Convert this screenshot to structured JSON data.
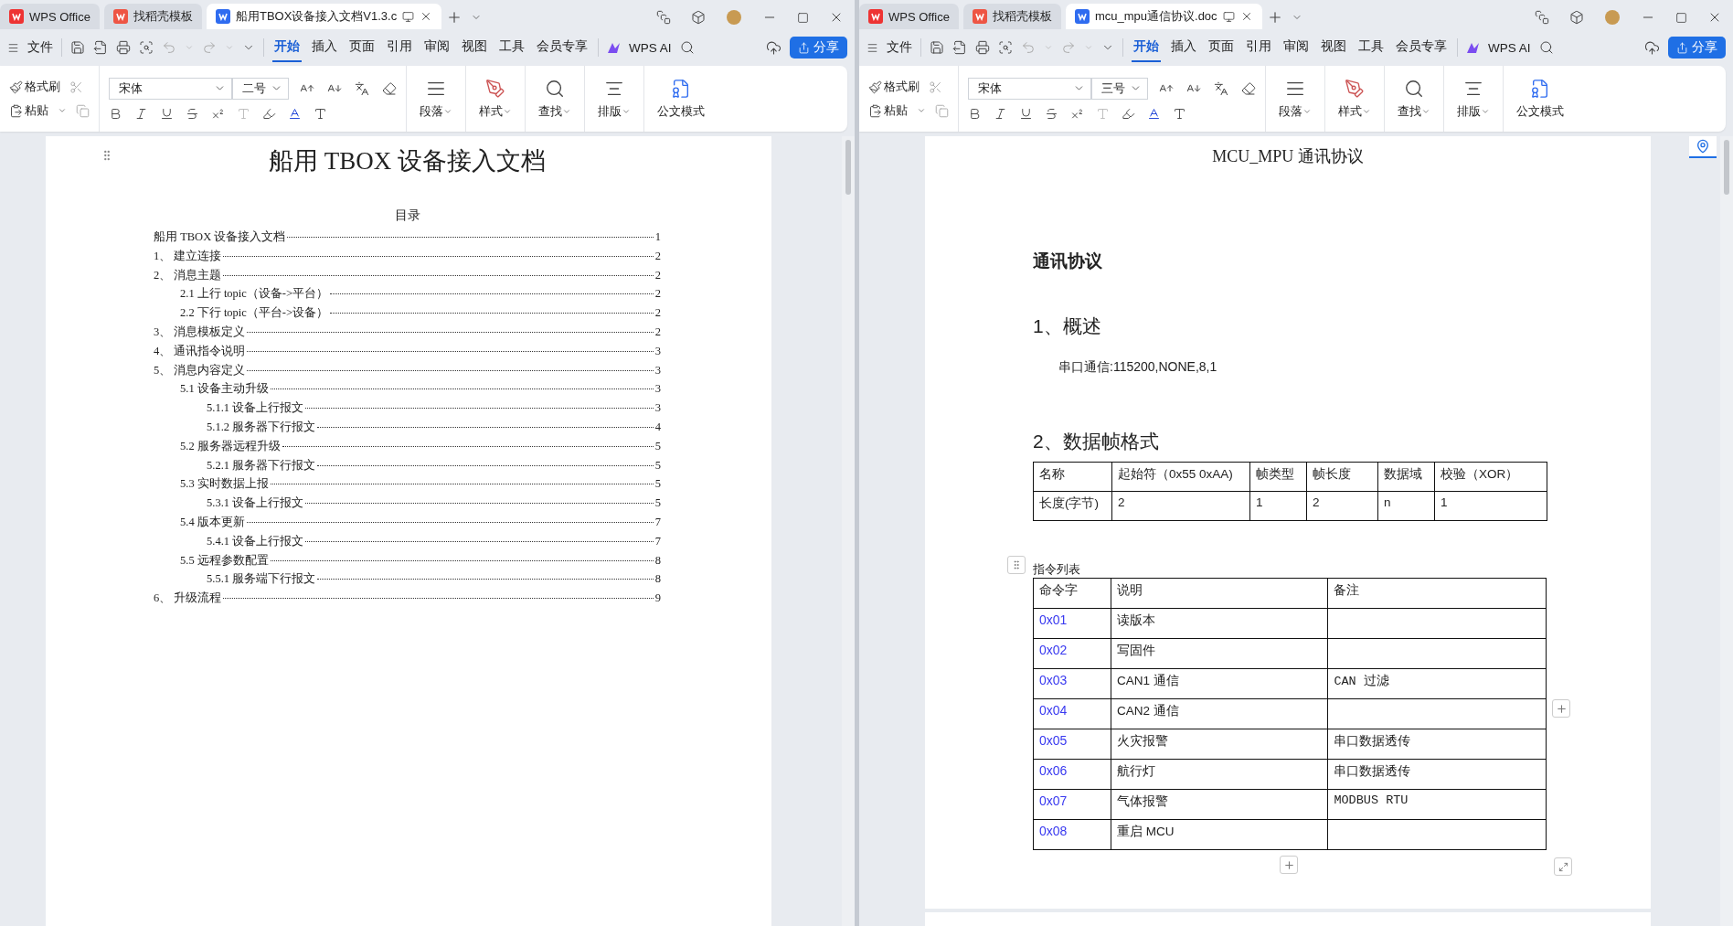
{
  "windows": [
    {
      "tabs": [
        {
          "label": "WPS Office",
          "kind": "home",
          "selected": false
        },
        {
          "label": "找稻壳模板",
          "kind": "template",
          "selected": false
        },
        {
          "label": "船用TBOX设备接入文档V1.3.c",
          "kind": "doc",
          "selected": true
        }
      ],
      "menu": {
        "file": "文件",
        "tabs": [
          {
            "label": "开始",
            "selected": true
          },
          {
            "label": "插入",
            "selected": false
          },
          {
            "label": "页面",
            "selected": false
          },
          {
            "label": "引用",
            "selected": false
          },
          {
            "label": "审阅",
            "selected": false
          },
          {
            "label": "视图",
            "selected": false
          },
          {
            "label": "工具",
            "selected": false
          },
          {
            "label": "会员专享",
            "selected": false
          }
        ],
        "ai": "WPS AI",
        "share": "分享"
      },
      "ribbon": {
        "format_painter": "格式刷",
        "paste": "粘贴",
        "font": "宋体",
        "size": "二号",
        "paragraph": "段落",
        "styles": "样式",
        "find": "查找",
        "layout": "排版",
        "official": "公文模式"
      },
      "document": {
        "kind": "toc",
        "title": "船用 TBOX 设备接入文档",
        "toc_heading": "目录",
        "entries": [
          {
            "title": "船用 TBOX 设备接入文档",
            "page": "1"
          },
          {
            "number": "1、",
            "title": "建立连接",
            "page": "2"
          },
          {
            "number": "2、",
            "title": "消息主题",
            "page": "2",
            "children": [
              {
                "number": "2.1",
                "title": "上行 topic（设备->平台）",
                "page": "2"
              },
              {
                "number": "2.2",
                "title": "下行 topic（平台->设备）",
                "page": "2"
              }
            ]
          },
          {
            "number": "3、",
            "title": "消息模板定义",
            "page": "2"
          },
          {
            "number": "4、",
            "title": "通讯指令说明",
            "page": "3"
          },
          {
            "number": "5、",
            "title": "消息内容定义",
            "page": "3",
            "children": [
              {
                "number": "5.1",
                "title": "设备主动升级",
                "page": "3",
                "children": [
                  {
                    "number": "5.1.1",
                    "title": "设备上行报文",
                    "page": "3"
                  },
                  {
                    "number": "5.1.2",
                    "title": "服务器下行报文",
                    "page": "4"
                  }
                ]
              },
              {
                "number": "5.2",
                "title": "服务器远程升级",
                "page": "5",
                "children": [
                  {
                    "number": "5.2.1",
                    "title": "服务器下行报文",
                    "page": "5"
                  }
                ]
              },
              {
                "number": "5.3",
                "title": "实时数据上报",
                "page": "5",
                "children": [
                  {
                    "number": "5.3.1",
                    "title": "设备上行报文",
                    "page": "5"
                  }
                ]
              },
              {
                "number": "5.4",
                "title": "版本更新",
                "page": "7",
                "children": [
                  {
                    "number": "5.4.1",
                    "title": "设备上行报文",
                    "page": "7"
                  }
                ]
              },
              {
                "number": "5.5",
                "title": "远程参数配置",
                "page": "8",
                "children": [
                  {
                    "number": "5.5.1",
                    "title": "服务端下行报文",
                    "page": "8"
                  }
                ]
              }
            ]
          },
          {
            "number": "6、",
            "title": "升级流程",
            "page": "9"
          }
        ]
      }
    },
    {
      "tabs": [
        {
          "label": "WPS Office",
          "kind": "home",
          "selected": false
        },
        {
          "label": "找稻壳模板",
          "kind": "template",
          "selected": false
        },
        {
          "label": "mcu_mpu通信协议.doc",
          "kind": "doc",
          "selected": true
        }
      ],
      "menu": {
        "file": "文件",
        "tabs": [
          {
            "label": "开始",
            "selected": true
          },
          {
            "label": "插入",
            "selected": false
          },
          {
            "label": "页面",
            "selected": false
          },
          {
            "label": "引用",
            "selected": false
          },
          {
            "label": "审阅",
            "selected": false
          },
          {
            "label": "视图",
            "selected": false
          },
          {
            "label": "工具",
            "selected": false
          },
          {
            "label": "会员专享",
            "selected": false
          }
        ],
        "ai": "WPS AI",
        "share": "分享"
      },
      "ribbon": {
        "format_painter": "格式刷",
        "paste": "粘贴",
        "font": "宋体",
        "size": "三号",
        "paragraph": "段落",
        "styles": "样式",
        "find": "查找",
        "layout": "排版",
        "official": "公文模式"
      },
      "document": {
        "kind": "protocol",
        "title": "MCU_MPU 通讯协议",
        "heading": "通讯协议",
        "section_1": "1、概述",
        "serial": "串口通信:115200,NONE,8,1",
        "section_2": "2、数据帧格式",
        "frame_table": {
          "columns": [
            "名称",
            "起始符（0x55 0xAA)",
            "帧类型",
            "帧长度",
            "数据域",
            "校验（XOR）"
          ],
          "rows": [
            [
              "长度(字节)",
              "2",
              "1",
              "2",
              "n",
              "1"
            ]
          ]
        },
        "command_caption": "指令列表",
        "command_table": {
          "columns": [
            "命令字",
            "说明",
            "备注"
          ],
          "rows": [
            {
              "code": "0x01",
              "description": "读版本"
            },
            {
              "code": "0x02",
              "description": "写固件"
            },
            {
              "code": "0x03",
              "description": "CAN1 通信",
              "note": "CAN 过滤"
            },
            {
              "code": "0x04",
              "description": "CAN2 通信"
            },
            {
              "code": "0x05",
              "description": "火灾报警",
              "note": "串口数据透传"
            },
            {
              "code": "0x06",
              "description": "航行灯",
              "note": "串口数据透传"
            },
            {
              "code": "0x07",
              "description": "气体报警",
              "note": "MODBUS RTU"
            },
            {
              "code": "0x08",
              "description": "重启 MCU"
            }
          ]
        }
      }
    }
  ]
}
